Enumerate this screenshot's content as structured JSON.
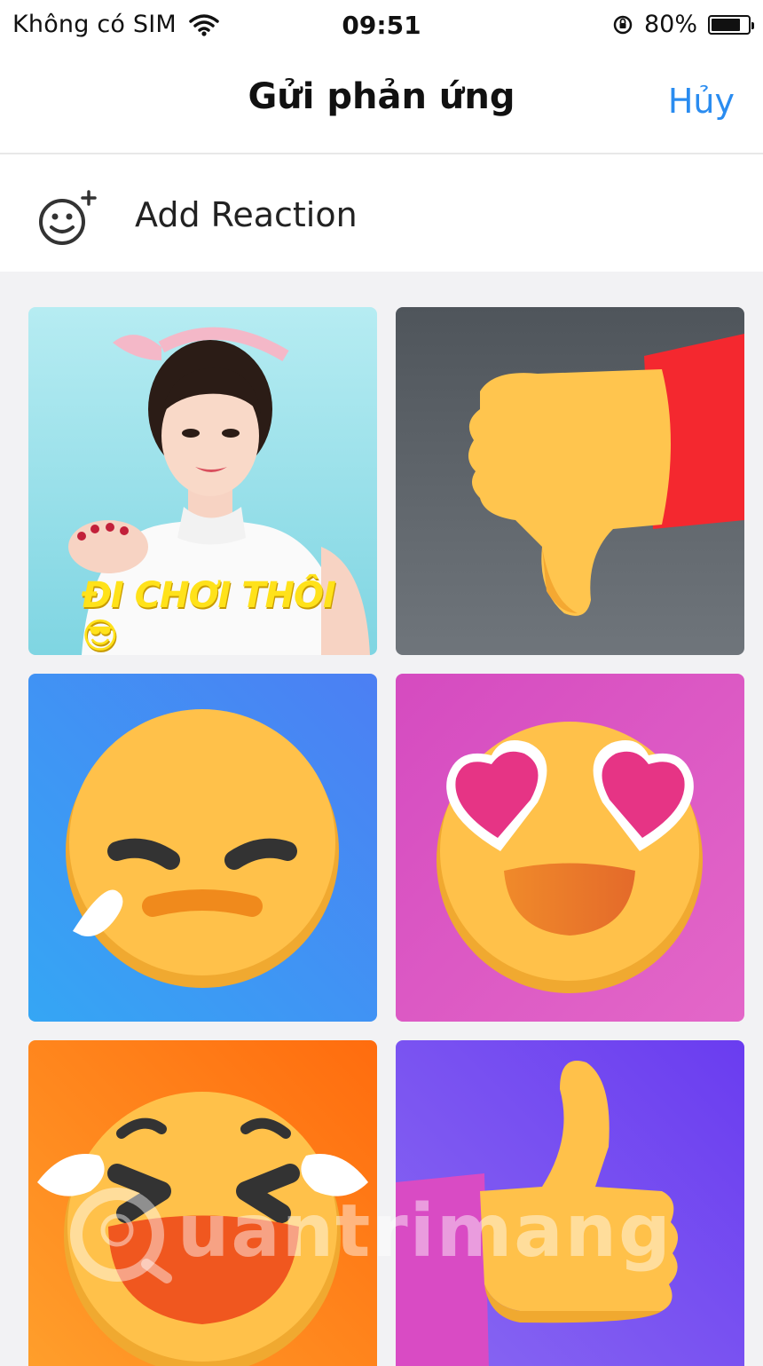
{
  "status_bar": {
    "carrier": "Không có SIM",
    "time": "09:51",
    "battery": "80%",
    "battery_level": 0.8
  },
  "nav": {
    "title": "Gửi phản ứng",
    "cancel_label": "Hủy"
  },
  "add_reaction": {
    "label": "Add Reaction",
    "icon": "smiley-add-icon"
  },
  "reactions": [
    {
      "name": "di-choi-thoi-sticker",
      "caption": "ĐI CHƠI THÔI 😎",
      "bg": "#a9e4ec"
    },
    {
      "name": "thumbs-down",
      "bg": "#5d6268"
    },
    {
      "name": "sad-tear-face",
      "bg": "#3d8ff2"
    },
    {
      "name": "heart-eyes-face",
      "bg": "#d84fc4"
    },
    {
      "name": "laughing-tears-face",
      "bg": "#ff8a1e"
    },
    {
      "name": "thumbs-up",
      "bg": "#7a58f0"
    }
  ],
  "watermark": {
    "text": "uantrimang"
  },
  "colors": {
    "accent": "#2a8cf0",
    "emoji_yellow": "#ffc14a"
  }
}
